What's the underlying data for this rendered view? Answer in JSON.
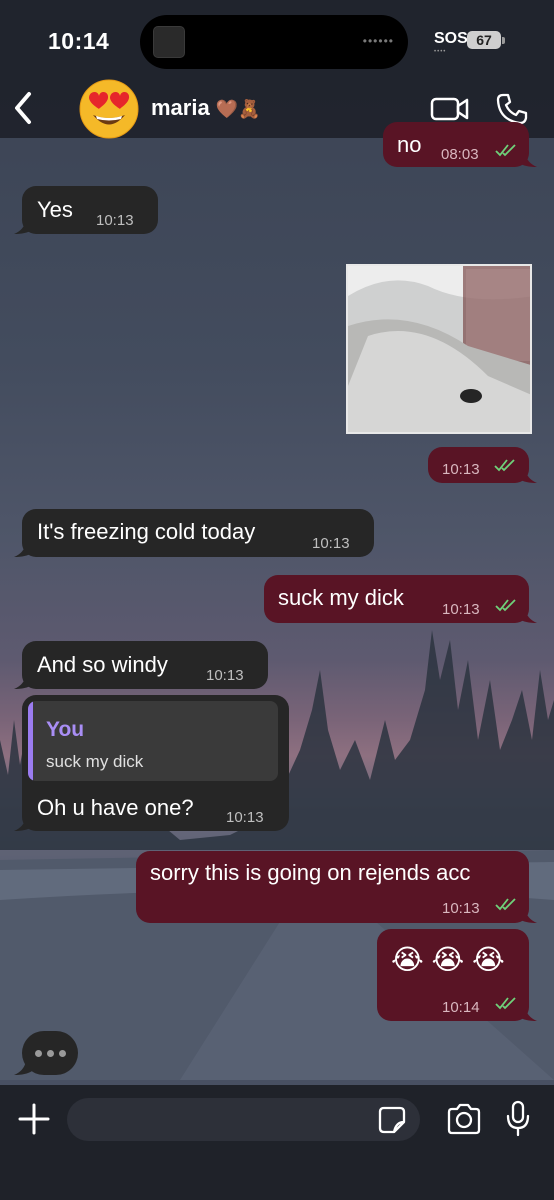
{
  "status_bar": {
    "time": "10:14",
    "sos": "SOS",
    "battery": "67"
  },
  "header": {
    "name": "maria",
    "name_emojis": "🤎🧸",
    "avatar_emoji": "😍"
  },
  "messages": [
    {
      "direction": "out",
      "text": "no",
      "time": "08:03",
      "read": true
    },
    {
      "direction": "in",
      "text": "Yes",
      "time": "10:13"
    },
    {
      "direction": "out",
      "type": "photo",
      "time": "10:13",
      "read": true
    },
    {
      "direction": "in",
      "text": "It's freezing cold today",
      "time": "10:13"
    },
    {
      "direction": "out",
      "text": "suck my dick",
      "time": "10:13",
      "read": true
    },
    {
      "direction": "in",
      "text": "And so windy",
      "time": "10:13"
    },
    {
      "direction": "in",
      "reply_to": {
        "author": "You",
        "text": "suck my dick"
      },
      "text": "Oh u have one?",
      "time": "10:13"
    },
    {
      "direction": "out",
      "text": "sorry this is going on rejends acc",
      "time": "10:13",
      "read": true
    },
    {
      "direction": "out",
      "text": "😭 😭 😭",
      "time": "10:14",
      "read": true
    }
  ],
  "composer": {
    "placeholder": ""
  },
  "colors": {
    "outgoing_bubble": "#591425",
    "incoming_bubble": "#262626",
    "read_tick": "#6fd27a",
    "reply_accent": "#a98ef5"
  },
  "icons": [
    "back-chevron-icon",
    "video-call-icon",
    "phone-icon",
    "plus-icon",
    "sticker-icon",
    "camera-icon",
    "microphone-icon"
  ]
}
